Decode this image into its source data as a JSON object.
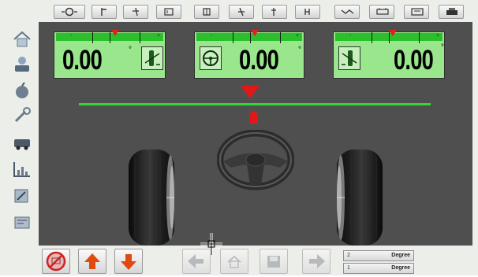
{
  "window": {
    "title": ""
  },
  "toolbar": {
    "buttons": [
      {
        "icon": "steering-dropdown-icon"
      },
      {
        "icon": "caster-icon"
      },
      {
        "icon": "camber-icon"
      },
      {
        "icon": "toe-icon"
      },
      {
        "icon": "wheel-icon"
      },
      {
        "icon": "kingpin-icon"
      },
      {
        "icon": "axle-icon"
      },
      {
        "icon": "offset-icon"
      },
      {
        "icon": "setback-icon"
      },
      {
        "icon": "vehicle-icon"
      },
      {
        "icon": "print-icon"
      },
      {
        "icon": "printer-icon"
      }
    ]
  },
  "sidebar": {
    "items": [
      {
        "icon": "home-icon"
      },
      {
        "icon": "customer-icon"
      },
      {
        "icon": "apple-icon"
      },
      {
        "icon": "wrench-icon"
      },
      {
        "icon": "car-icon"
      },
      {
        "icon": "chart-icon"
      },
      {
        "icon": "tools-icon"
      },
      {
        "icon": "settings-icon"
      }
    ]
  },
  "gauges": [
    {
      "label": "left-gauge",
      "value": "0.00",
      "unit": "°",
      "minus": "-",
      "plus": "+",
      "icon": "left-wheel-adjust-icon"
    },
    {
      "label": "center-gauge",
      "value": "0.00",
      "unit": "°",
      "minus": "-",
      "plus": "+",
      "icon": "steering-wheel-icon"
    },
    {
      "label": "right-gauge",
      "value": "0.00",
      "unit": "°",
      "minus": "-",
      "plus": "+",
      "icon": "right-wheel-adjust-icon"
    }
  ],
  "scene": {
    "line_color": "#34d634",
    "marker_color": "#e01818",
    "background": "#4f4f4f"
  },
  "bottom": {
    "buttons": [
      {
        "icon": "cancel-icon"
      },
      {
        "icon": "arrow-up-icon"
      },
      {
        "icon": "arrow-down-icon"
      },
      {
        "icon": "arrow-left-icon"
      },
      {
        "icon": "home-icon"
      },
      {
        "icon": "save-icon"
      },
      {
        "icon": "arrow-right-icon"
      }
    ],
    "readouts": [
      {
        "number": "2",
        "unit": "Degree"
      },
      {
        "number": "1",
        "unit": "Degree"
      }
    ]
  }
}
